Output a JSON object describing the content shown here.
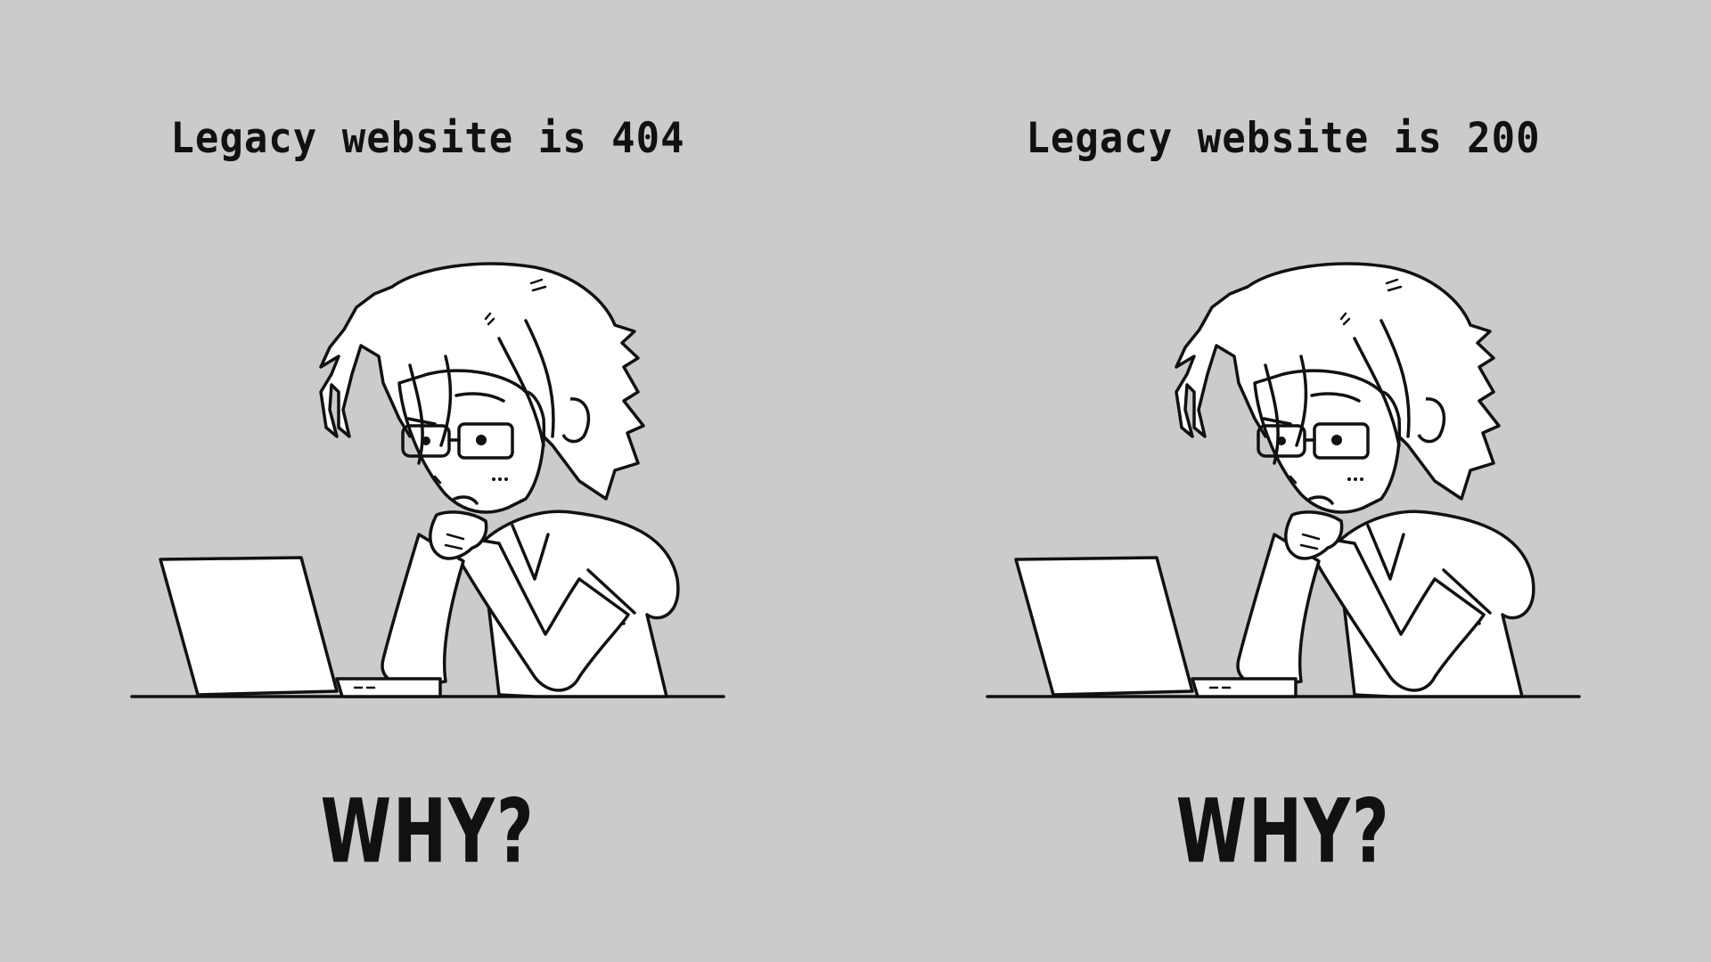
{
  "panels": [
    {
      "caption": "Legacy website is 404",
      "question": "WHY?",
      "illustration": "girl-at-laptop-confused"
    },
    {
      "caption": "Legacy website is 200",
      "question": "WHY?",
      "illustration": "girl-at-laptop-confused"
    }
  ],
  "colors": {
    "background": "#cbcbcb",
    "ink": "#111111",
    "paper": "#ffffff"
  }
}
